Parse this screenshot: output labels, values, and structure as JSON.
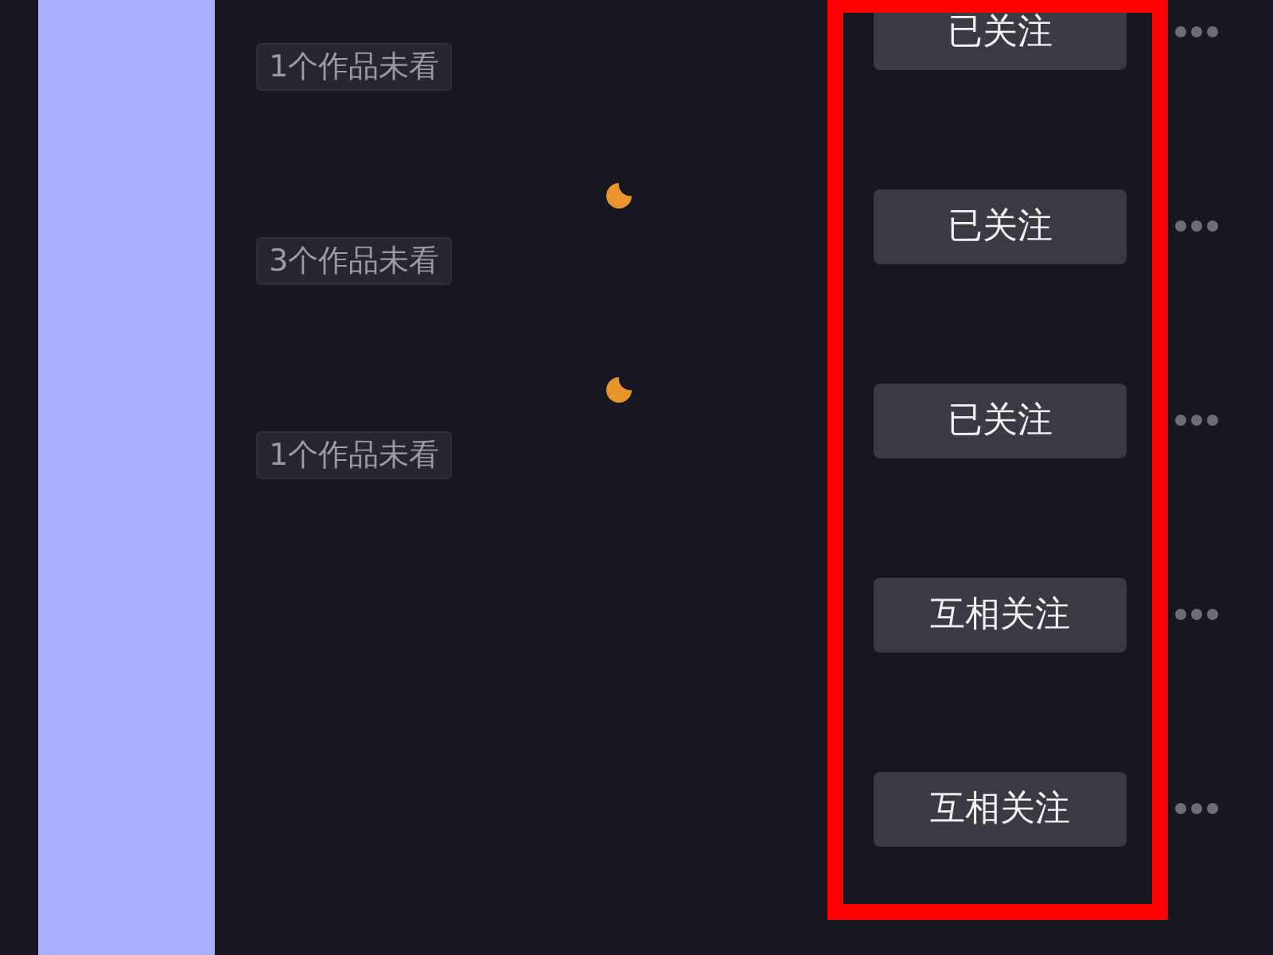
{
  "rows": [
    {
      "button_label": "已关注",
      "badge": "1个作品未看",
      "moon": false
    },
    {
      "button_label": "已关注",
      "badge": "3个作品未看",
      "moon": true
    },
    {
      "button_label": "已关注",
      "badge": "1个作品未看",
      "moon": true
    },
    {
      "button_label": "互相关注",
      "moon": false
    },
    {
      "button_label": "互相关注",
      "moon": false
    }
  ],
  "highlight": {
    "on": true
  }
}
